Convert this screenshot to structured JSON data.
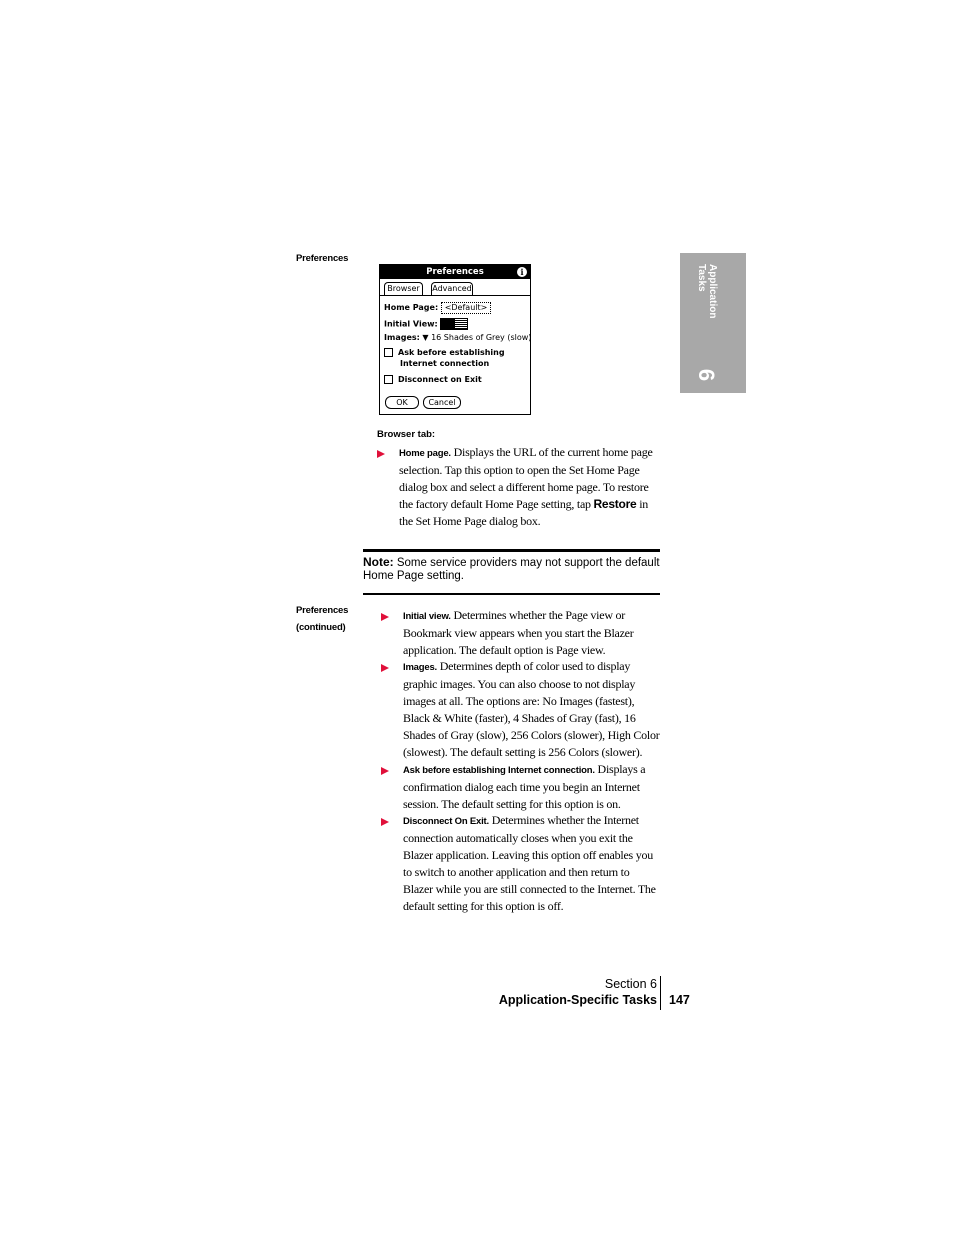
{
  "side_headings": {
    "first": "Preferences",
    "second_line1": "Preferences",
    "second_line2": "(continued)"
  },
  "thumb_tab": {
    "label_line1": "Application",
    "label_line2": "Tasks",
    "section_number": "6",
    "color": "#a8a8a8"
  },
  "palm_screen": {
    "title": "Preferences",
    "info_icon": "i",
    "tabs": [
      "Browser",
      "Advanced"
    ],
    "home_page_label": "Home Page:",
    "home_page_value": "<Default>",
    "initial_view_label": "Initial View:",
    "images_label": "Images:",
    "images_value": "16 Shades of Grey (slow)",
    "checkbox1_line1": "Ask before establishing",
    "checkbox1_line2": "Internet connection",
    "checkbox2": "Disconnect on Exit",
    "ok_button": "OK",
    "cancel_button": "Cancel"
  },
  "browser_tab": {
    "heading": "Browser tab:",
    "home_page": {
      "lead": "Home page.",
      "text1": " Displays the URL of the current home page selection. Tap this option to open the Set Home Page dialog box and select a different home page. To restore the factory default Home Page setting, tap ",
      "restore": "Restore",
      "text2": " in the Set Home Page dialog box."
    }
  },
  "note": {
    "label": "Note:",
    "text": " Some service providers may not support the default Home Page setting."
  },
  "continued_items": [
    {
      "lead": "Initial view.",
      "text": " Determines whether the Page view or Bookmark view appears when you start the Blazer application. The default option is Page view."
    },
    {
      "lead": "Images.",
      "text": " Determines depth of color used to display graphic images. You can also choose to not display images at all. The options are: No Images (fastest), Black & White (faster), 4 Shades of Gray (fast), 16 Shades of Gray (slow), 256 Colors (slower), High Color (slowest). The default setting is 256 Colors (slower)."
    },
    {
      "lead": "Ask before establishing Internet connection.",
      "text": " Displays a confirmation dialog each time you begin an Internet session. The default setting for this option is on."
    },
    {
      "lead": "Disconnect On Exit.",
      "text": " Determines whether the Internet connection automatically closes when you exit the Blazer application. Leaving this option off enables you to switch to another application and then return to Blazer while you are still connected to the Internet. The default setting for this option is off."
    }
  ],
  "footer": {
    "section": "Section 6",
    "title": "Application-Specific Tasks",
    "page": "147"
  },
  "colors": {
    "bullet_arrow": "#e0103a"
  }
}
